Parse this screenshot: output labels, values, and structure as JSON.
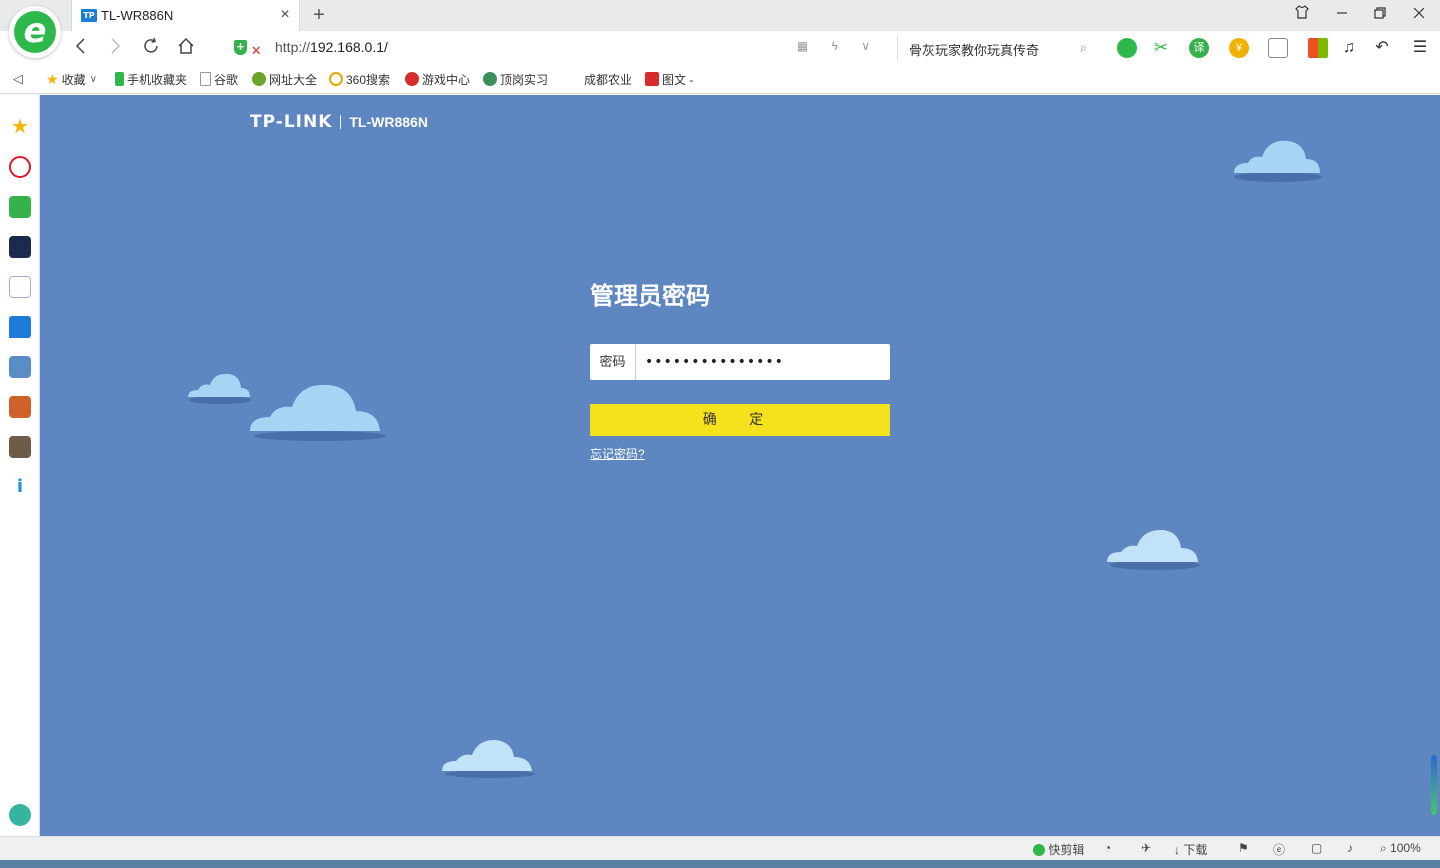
{
  "browser": {
    "tab_title": "TL-WR886N",
    "tab_favicon_text": "TP",
    "new_tab_icon": "plus-icon",
    "close_icon": "×",
    "url_prefix": "http://",
    "url_host": "192.168.0.1/",
    "search_text": "骨灰玩家教你玩真传奇",
    "logo_letter": "e"
  },
  "bookmarks": {
    "collapse": "◁",
    "favorites": "收藏",
    "items": [
      "手机收藏夹",
      "谷歌",
      "网址大全",
      "360搜索",
      "游戏中心",
      "顶岗实习",
      "成都农业",
      "图文 -"
    ]
  },
  "page": {
    "brand_logo": "TP-LINK",
    "brand_model": "TL-WR886N",
    "title": "管理员密码",
    "password_label": "密码",
    "password_value": "•••••••••••••••",
    "submit_label": "确 定",
    "forgot_link": "忘记密码?"
  },
  "status": {
    "quick_edit": "快剪辑",
    "download": "下载",
    "zoom": "100%"
  },
  "colors": {
    "background": "#5e86c1",
    "submit": "#f5e21c",
    "accent_green": "#2eb84b"
  }
}
